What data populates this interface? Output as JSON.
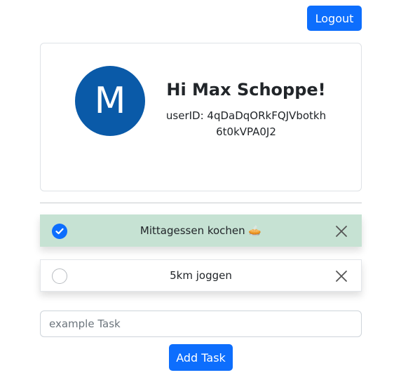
{
  "header": {
    "logout_label": "Logout"
  },
  "profile": {
    "avatar_initial": "M",
    "greeting": "Hi Max Schoppe!",
    "userid_line": "userID: 4qDaDqORkFQJVbotkh6t0kVPA0J2"
  },
  "tasks": [
    {
      "label": "Mittagessen kochen 🥧",
      "completed": true
    },
    {
      "label": "5km joggen",
      "completed": false
    }
  ],
  "new_task": {
    "placeholder": "example Task",
    "value": "",
    "button_label": "Add Task"
  },
  "colors": {
    "primary": "#0d6efd",
    "avatar": "#0a5aa8",
    "completed_row": "#c6e2d3"
  }
}
